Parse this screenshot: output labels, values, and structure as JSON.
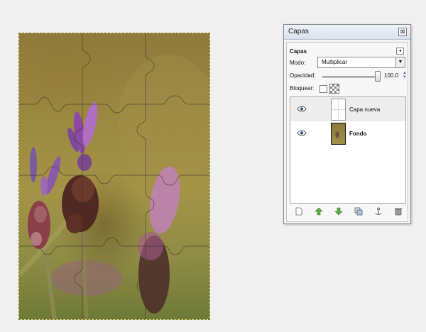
{
  "layers_dialog": {
    "title": "Capas",
    "close_icon": "close-icon",
    "section_label": "Capas",
    "panel_menu_icon": "panel-menu-icon",
    "mode": {
      "label": "Modo:",
      "value": "Multiplicar"
    },
    "opacity": {
      "label": "Opacidad:",
      "value": "100.0",
      "level_percent": 100
    },
    "lock": {
      "label": "Bloquear:",
      "pixels_locked": false,
      "alpha_locked": false
    },
    "layers": [
      {
        "name": "Capa nueva",
        "visible": true,
        "selected": true,
        "visibility_icon": "eye-icon"
      },
      {
        "name": "Fondo",
        "visible": true,
        "selected": false,
        "visibility_icon": "eye-icon"
      }
    ],
    "toolbar": [
      {
        "icon": "new-layer-icon"
      },
      {
        "icon": "raise-layer-icon"
      },
      {
        "icon": "lower-layer-icon"
      },
      {
        "icon": "duplicate-layer-icon"
      },
      {
        "icon": "anchor-layer-icon"
      },
      {
        "icon": "delete-layer-icon"
      }
    ]
  },
  "canvas": {
    "image_subject": "lavender flower photo with jigsaw puzzle overlay",
    "selection": "marching-ants"
  }
}
